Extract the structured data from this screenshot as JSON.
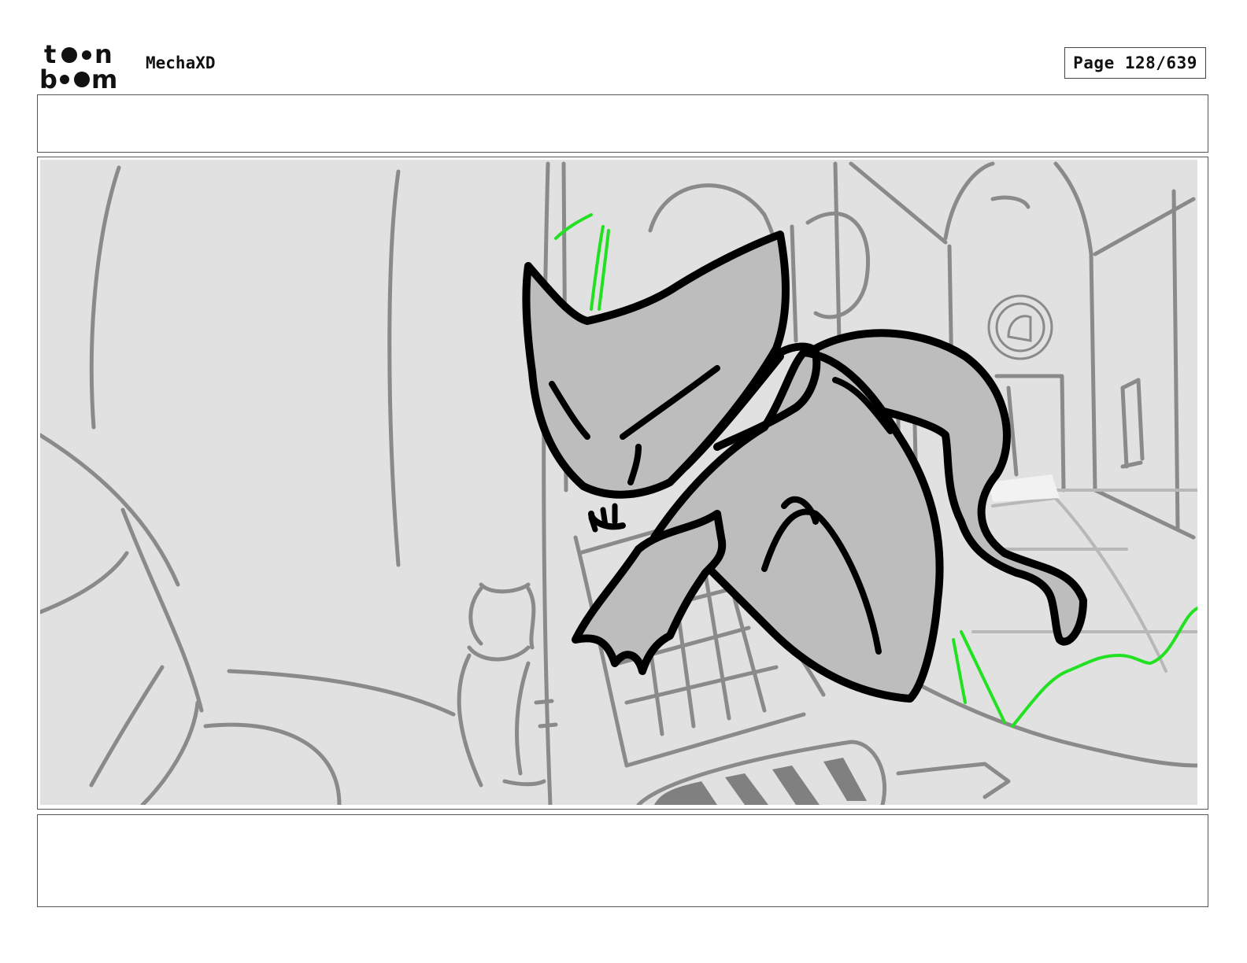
{
  "header": {
    "logo_text": "toon boom",
    "project_title": "MechaXD",
    "page_label": "Page 128/639"
  },
  "panel": {
    "caption_top": "",
    "caption_bottom": "",
    "colors": {
      "background": "#e1e1e1",
      "sketch_lines": "#8a8a8a",
      "character_fill": "#bdbdbd",
      "outline": "#000000",
      "motion_lines": "#22e022"
    }
  }
}
